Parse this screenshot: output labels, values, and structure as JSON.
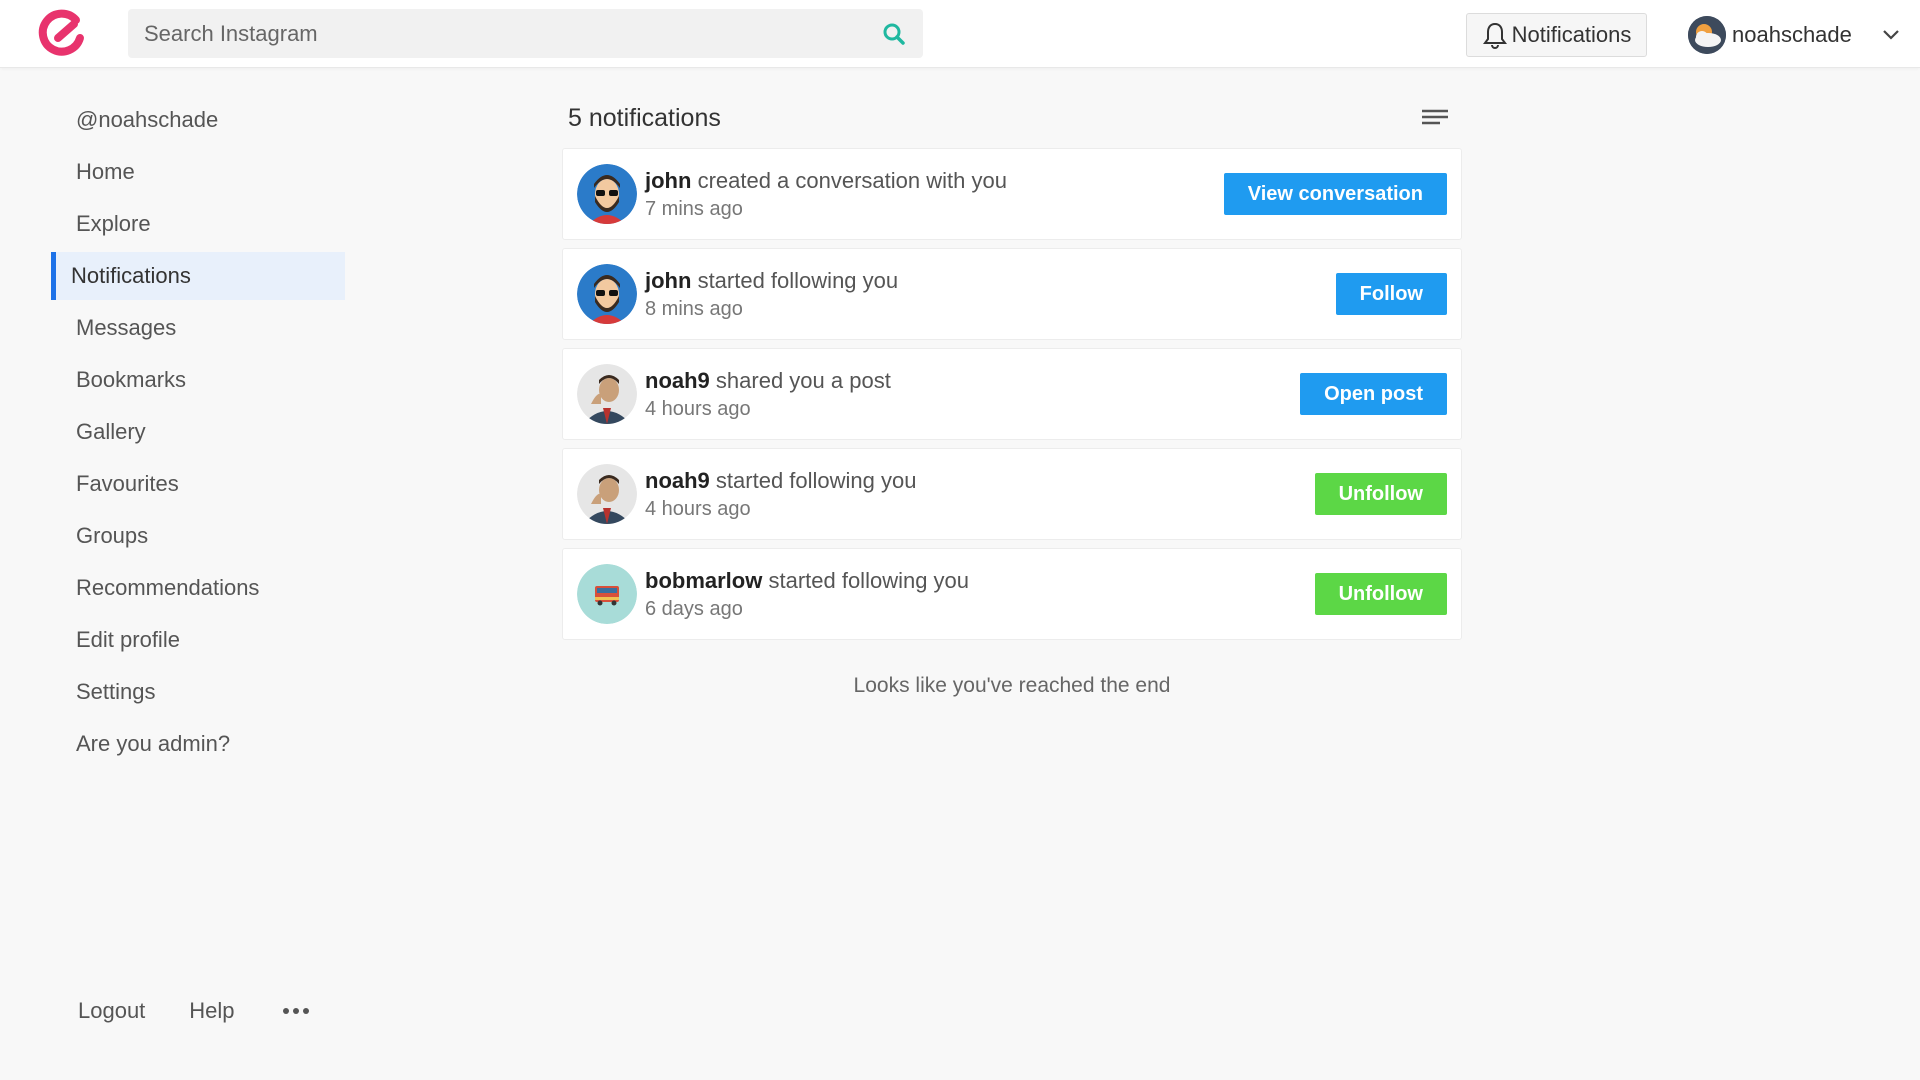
{
  "header": {
    "search_placeholder": "Search Instagram",
    "notifications_label": "Notifications",
    "username": "noahschade"
  },
  "sidebar": {
    "items": [
      {
        "label": "@noahschade",
        "active": false
      },
      {
        "label": "Home",
        "active": false
      },
      {
        "label": "Explore",
        "active": false
      },
      {
        "label": "Notifications",
        "active": true
      },
      {
        "label": "Messages",
        "active": false
      },
      {
        "label": "Bookmarks",
        "active": false
      },
      {
        "label": "Gallery",
        "active": false
      },
      {
        "label": "Favourites",
        "active": false
      },
      {
        "label": "Groups",
        "active": false
      },
      {
        "label": "Recommendations",
        "active": false
      },
      {
        "label": "Edit profile",
        "active": false
      },
      {
        "label": "Settings",
        "active": false
      },
      {
        "label": "Are you admin?",
        "active": false
      }
    ],
    "footer": {
      "logout": "Logout",
      "help": "Help"
    }
  },
  "main": {
    "count_label": "5 notifications",
    "notifications": [
      {
        "user": "john",
        "text": "created a conversation with you",
        "time": "7 mins ago",
        "action": "View conversation",
        "action_color": "blue",
        "avatar": "hipster-avatar"
      },
      {
        "user": "john",
        "text": "started following you",
        "time": "8 mins ago",
        "action": "Follow",
        "action_color": "blue",
        "avatar": "hipster-avatar"
      },
      {
        "user": "noah9",
        "text": "shared you a post",
        "time": "4 hours ago",
        "action": "Open post",
        "action_color": "blue",
        "avatar": "man-suit-avatar"
      },
      {
        "user": "noah9",
        "text": "started following you",
        "time": "4 hours ago",
        "action": "Unfollow",
        "action_color": "green",
        "avatar": "man-suit-avatar"
      },
      {
        "user": "bobmarlow",
        "text": "started following you",
        "time": "6 days ago",
        "action": "Unfollow",
        "action_color": "green",
        "avatar": "bus-avatar"
      }
    ],
    "end_text": "Looks like you've reached the end"
  },
  "colors": {
    "brand": "#e8336d",
    "active_accent": "#1d72e8",
    "blue_button": "#1f9bf0",
    "green_button": "#5cd746",
    "search_icon": "#1fb8a0"
  }
}
